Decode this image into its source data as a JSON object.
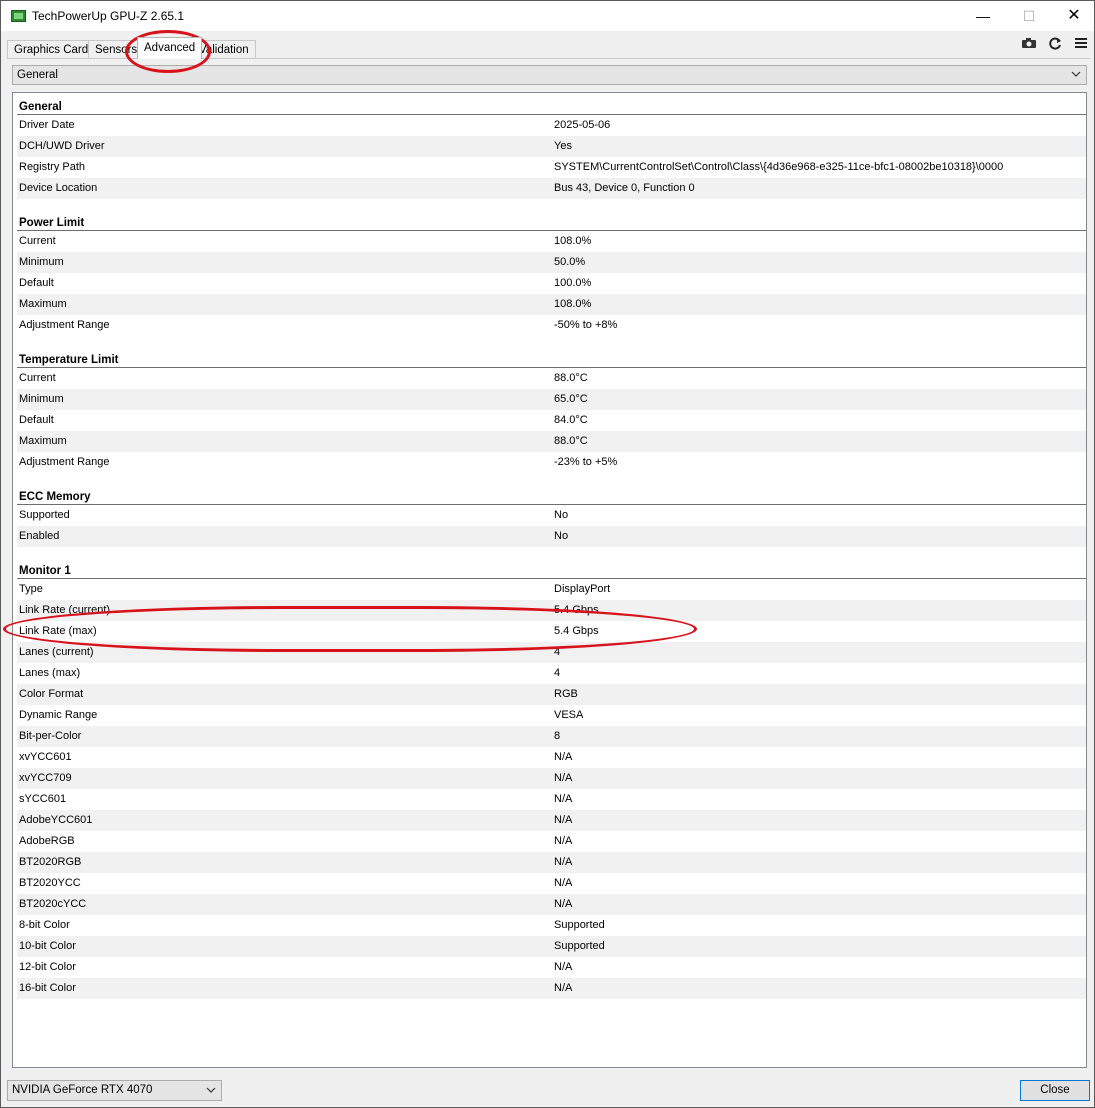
{
  "window": {
    "title": "TechPowerUp GPU-Z 2.65.1",
    "controls": {
      "minimize": "—",
      "maximize": "☐",
      "close": "✕"
    }
  },
  "tabs": [
    "Graphics Card",
    "Sensors",
    "Advanced",
    "Validation"
  ],
  "active_tab": "Advanced",
  "toolbar": {
    "camera_icon": "camera-icon",
    "refresh_icon": "refresh-icon",
    "menu_icon": "menu-icon"
  },
  "category_select": {
    "value": "General"
  },
  "groups": [
    {
      "title": "General",
      "rows": [
        [
          "Driver Date",
          "2025-05-06"
        ],
        [
          "DCH/UWD Driver",
          "Yes"
        ],
        [
          "Registry Path",
          "SYSTEM\\CurrentControlSet\\Control\\Class\\{4d36e968-e325-11ce-bfc1-08002be10318}\\0000"
        ],
        [
          "Device Location",
          "Bus 43, Device 0, Function 0"
        ]
      ]
    },
    {
      "title": "Power Limit",
      "rows": [
        [
          "Current",
          "108.0%"
        ],
        [
          "Minimum",
          "50.0%"
        ],
        [
          "Default",
          "100.0%"
        ],
        [
          "Maximum",
          "108.0%"
        ],
        [
          "Adjustment Range",
          "-50% to +8%"
        ]
      ]
    },
    {
      "title": "Temperature Limit",
      "rows": [
        [
          "Current",
          "88.0°C"
        ],
        [
          "Minimum",
          "65.0°C"
        ],
        [
          "Default",
          "84.0°C"
        ],
        [
          "Maximum",
          "88.0°C"
        ],
        [
          "Adjustment Range",
          "-23% to +5%"
        ]
      ]
    },
    {
      "title": "ECC Memory",
      "rows": [
        [
          "Supported",
          "No"
        ],
        [
          "Enabled",
          "No"
        ]
      ]
    },
    {
      "title": "Monitor 1",
      "rows": [
        [
          "Type",
          "DisplayPort"
        ],
        [
          "Link Rate (current)",
          "5.4 Gbps"
        ],
        [
          "Link Rate (max)",
          "5.4 Gbps"
        ],
        [
          "Lanes (current)",
          "4"
        ],
        [
          "Lanes (max)",
          "4"
        ],
        [
          "Color Format",
          "RGB"
        ],
        [
          "Dynamic Range",
          "VESA"
        ],
        [
          "Bit-per-Color",
          "8"
        ],
        [
          "xvYCC601",
          "N/A"
        ],
        [
          "xvYCC709",
          "N/A"
        ],
        [
          "sYCC601",
          "N/A"
        ],
        [
          "AdobeYCC601",
          "N/A"
        ],
        [
          "AdobeRGB",
          "N/A"
        ],
        [
          "BT2020RGB",
          "N/A"
        ],
        [
          "BT2020YCC",
          "N/A"
        ],
        [
          "BT2020cYCC",
          "N/A"
        ],
        [
          "8-bit Color",
          "Supported"
        ],
        [
          "10-bit Color",
          "Supported"
        ],
        [
          "12-bit Color",
          "N/A"
        ],
        [
          "16-bit Color",
          "N/A"
        ]
      ]
    }
  ],
  "gpu_select": {
    "value": "NVIDIA GeForce RTX 4070"
  },
  "close_button": {
    "label": "Close"
  },
  "colors": {
    "annotation": "#d8121b",
    "focus": "#0078d7"
  }
}
